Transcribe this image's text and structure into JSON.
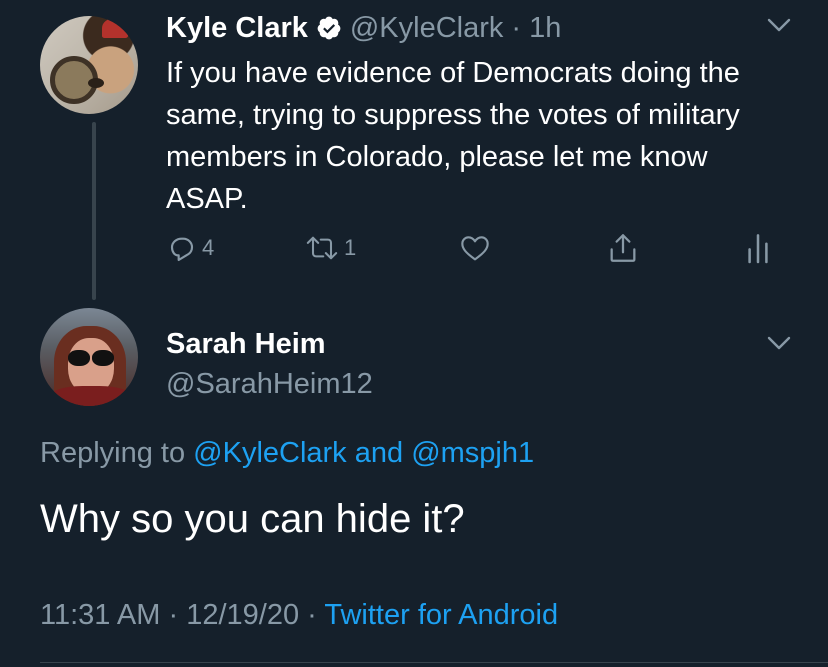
{
  "parent_tweet": {
    "author_name": "Kyle Clark",
    "author_handle": "@KyleClark",
    "separator": "·",
    "time_ago": "1h",
    "text": "If you have evidence of Democrats doing the same, trying to suppress the votes of military members in Colorado, please let me know ASAP.",
    "reply_count": "4",
    "retweet_count": "1"
  },
  "main_tweet": {
    "author_name": "Sarah Heim",
    "author_handle": "@SarahHeim12",
    "replying_prefix": "Replying to",
    "replying_to_1": "@KyleClark",
    "replying_and": "and",
    "replying_to_2": "@mspjh1",
    "text": "Why so you can hide it?",
    "time": "11:31 AM",
    "date": "12/19/20",
    "meta_separator": "·",
    "source": "Twitter for Android"
  },
  "icons": {
    "verified": "verified-badge-icon",
    "caret": "chevron-down-icon",
    "reply": "reply-icon",
    "retweet": "retweet-icon",
    "like": "heart-icon",
    "share": "share-icon",
    "analytics": "analytics-icon"
  },
  "colors": {
    "background": "#15202b",
    "text_primary": "#ffffff",
    "text_secondary": "#8899a6",
    "link": "#1da1f2",
    "divider": "#38444d"
  }
}
